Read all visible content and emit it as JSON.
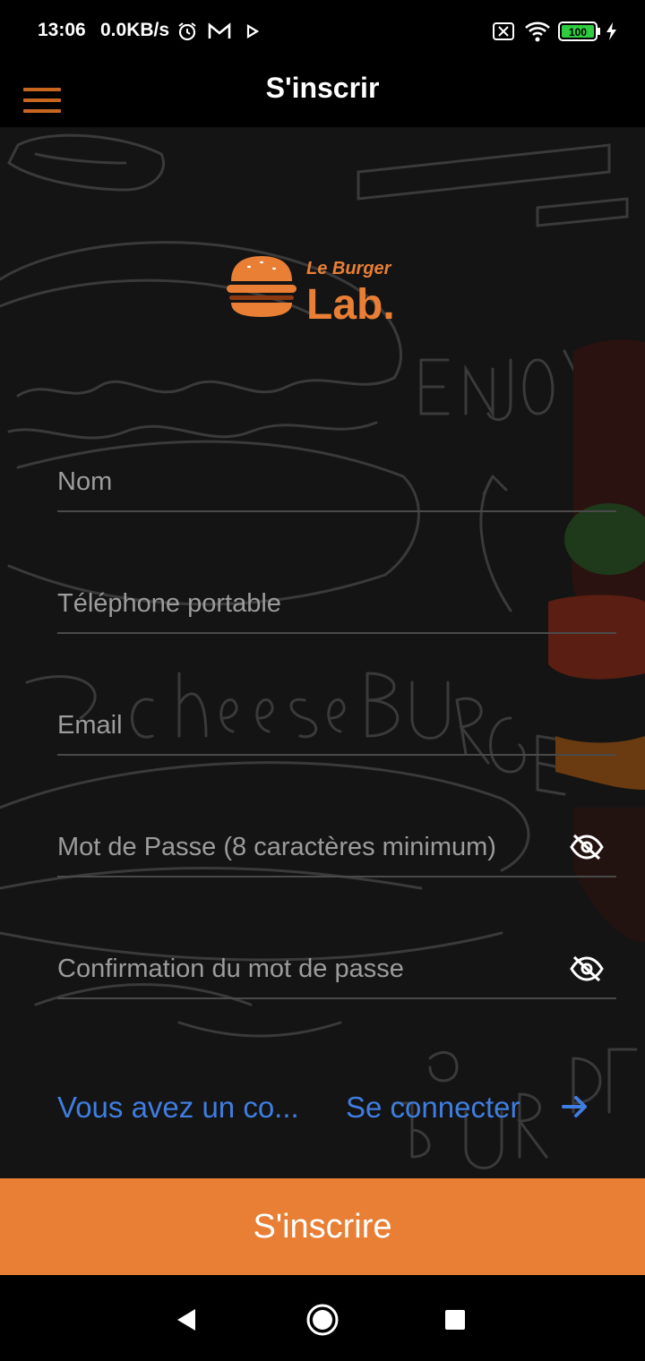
{
  "status_bar": {
    "time": "13:06",
    "speed": "0.0KB/s",
    "battery": "100",
    "icons": [
      "alarm-icon",
      "gmail-icon",
      "play-icon",
      "sim-off-icon",
      "wifi-icon",
      "battery-icon",
      "charging-icon"
    ]
  },
  "app_bar": {
    "title": "S'inscrir",
    "menu_icon": "hamburger-menu-icon"
  },
  "logo": {
    "line1": "Le Burger",
    "line2": "Lab."
  },
  "form": {
    "name_placeholder": "Nom",
    "phone_placeholder": "Téléphone portable",
    "email_placeholder": "Email",
    "password_placeholder": "Mot de Passe (8 caractères minimum)",
    "confirm_placeholder": "Confirmation du mot de passe"
  },
  "login": {
    "prompt": "Vous avez un co...",
    "link": "Se connecter"
  },
  "submit_label": "S'inscrire",
  "colors": {
    "accent": "#e87f35",
    "link": "#3f7de0",
    "menu": "#c8651f"
  }
}
